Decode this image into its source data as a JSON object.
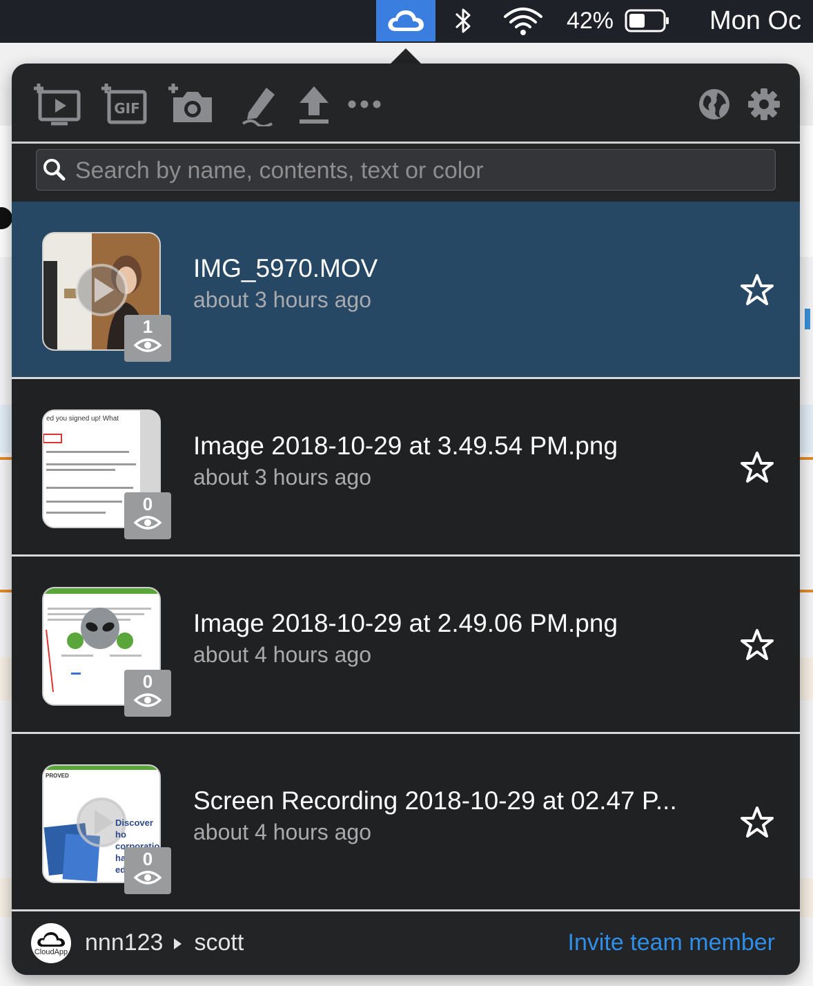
{
  "menubar": {
    "icons": [
      "cloudapp-icon",
      "bluetooth-icon",
      "wifi-icon",
      "battery-icon"
    ],
    "battery_percent": "42%",
    "clock": "Mon Oc"
  },
  "toolbar": {
    "buttons": [
      "record-screen-icon",
      "record-gif-icon",
      "screenshot-icon",
      "annotate-icon",
      "upload-icon",
      "more-icon"
    ],
    "right_buttons": [
      "web-icon",
      "settings-icon"
    ]
  },
  "search": {
    "placeholder": "Search by name, contents, text or color",
    "value": ""
  },
  "items": [
    {
      "name": "IMG_5970.MOV",
      "time": "about 3 hours ago",
      "views": "1",
      "type": "video",
      "selected": true
    },
    {
      "name": "Image 2018-10-29 at 3.49.54 PM.png",
      "time": "about 3 hours ago",
      "views": "0",
      "type": "image",
      "selected": false
    },
    {
      "name": "Image 2018-10-29 at 2.49.06 PM.png",
      "time": "about 4 hours ago",
      "views": "0",
      "type": "image",
      "selected": false
    },
    {
      "name": "Screen Recording 2018-10-29 at 02.47 P...",
      "time": "about 4 hours ago",
      "views": "0",
      "type": "video",
      "selected": false
    }
  ],
  "thumbs": {
    "item1": {
      "snippet": "ed you signed up! What"
    },
    "item3": {
      "header": "PROVED",
      "lines": [
        "Discover ho",
        "corporation",
        "handling th",
        "ed"
      ]
    }
  },
  "footer": {
    "avatar_label": "CloudApp",
    "account": "nnn123",
    "user": "scott",
    "invite": "Invite team member"
  },
  "colors": {
    "accent": "#2f8ee8",
    "selected_row": "#264865",
    "menubar_highlight": "#3a7ee0",
    "popover_bg": "#242527"
  }
}
